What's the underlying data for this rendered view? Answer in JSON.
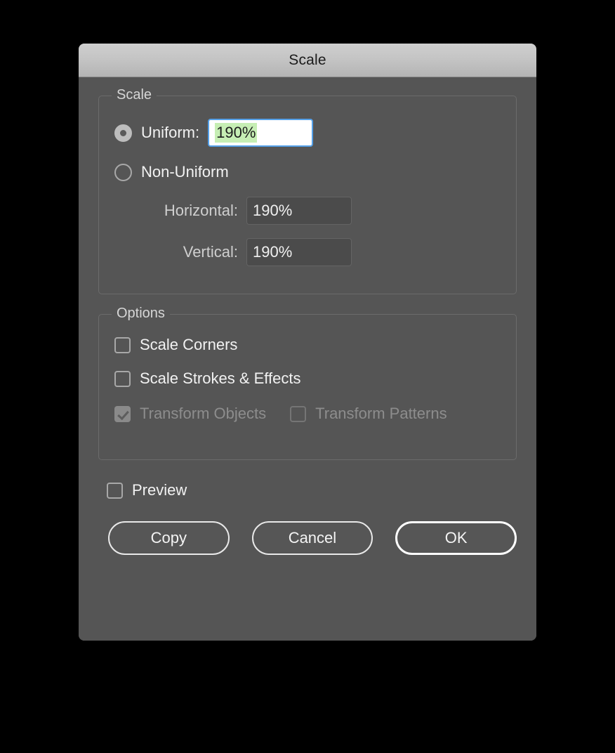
{
  "dialog": {
    "title": "Scale",
    "groups": {
      "scale": {
        "legend": "Scale",
        "uniform": {
          "label": "Uniform:",
          "selected": true,
          "value": "190%"
        },
        "non_uniform": {
          "label": "Non-Uniform",
          "selected": false
        },
        "horizontal": {
          "label": "Horizontal:",
          "value": "190%"
        },
        "vertical": {
          "label": "Vertical:",
          "value": "190%"
        }
      },
      "options": {
        "legend": "Options",
        "scale_corners": {
          "label": "Scale Corners",
          "checked": false
        },
        "scale_strokes": {
          "label": "Scale Strokes & Effects",
          "checked": false
        },
        "transform_objects": {
          "label": "Transform Objects",
          "checked": true,
          "disabled": true
        },
        "transform_patterns": {
          "label": "Transform Patterns",
          "checked": false,
          "disabled": true
        }
      }
    },
    "preview": {
      "label": "Preview",
      "checked": false
    },
    "buttons": {
      "copy": "Copy",
      "cancel": "Cancel",
      "ok": "OK"
    }
  },
  "colors": {
    "dialog_background": "#555555",
    "titlebar_top": "#cfcfcf",
    "titlebar_bottom": "#b4b4b4",
    "focus_border": "#54a0e8",
    "selection_highlight": "#c6eeb4",
    "field_dim_background": "#4b4b4b",
    "page_background": "#000000"
  }
}
